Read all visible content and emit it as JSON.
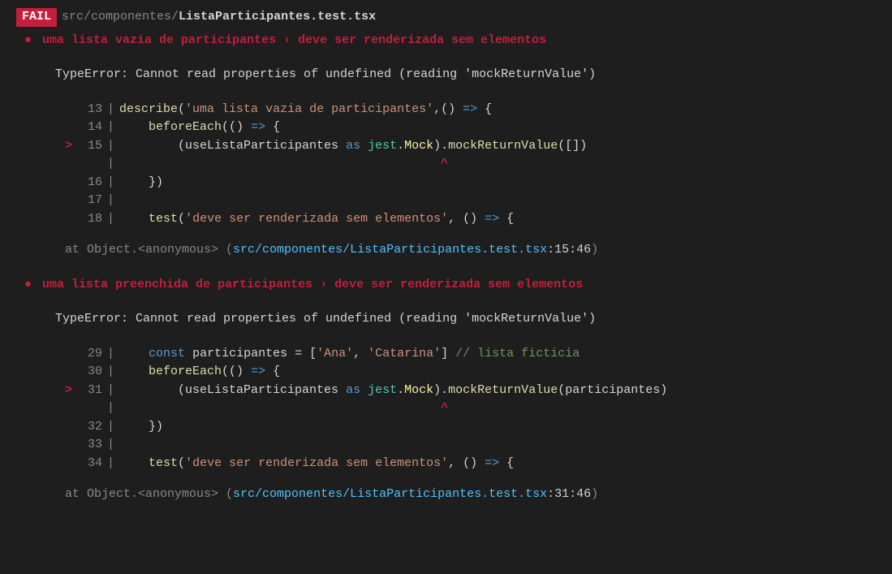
{
  "header": {
    "fail_label": "FAIL",
    "file_dir": "src/componentes/",
    "file_name": "ListaParticipantes.test.tsx"
  },
  "tests": [
    {
      "bullet": "●",
      "suite": "uma lista vazia de participantes",
      "chev": "›",
      "name": "deve ser renderizada sem elementos",
      "error": "TypeError: Cannot read properties of undefined (reading 'mockReturnValue')",
      "code": {
        "l13": {
          "num": "13",
          "marker": " ",
          "describe": "describe",
          "p1": "(",
          "str": "'uma lista vazia de participantes'",
          "p2": ",() ",
          "arrow": "=>",
          "p3": " {"
        },
        "l14": {
          "num": "14",
          "marker": " ",
          "indent": "    ",
          "before": "beforeEach",
          "p1": "(() ",
          "arrow": "=>",
          "p2": " {"
        },
        "l15": {
          "num": "15",
          "marker": ">",
          "indent": "        ",
          "p1": "(useListaParticipantes ",
          "as": "as",
          "sp1": " ",
          "jest": "jest",
          "dot1": ".",
          "mock": "Mock",
          "p2": ").",
          "mret": "mockReturnValue",
          "p3": "([])"
        },
        "caret": {
          "marker": " ",
          "num": "  ",
          "indent": "                                            ",
          "caret": "^"
        },
        "l16": {
          "num": "16",
          "marker": " ",
          "indent": "    ",
          "p1": "})"
        },
        "l17": {
          "num": "17",
          "marker": " "
        },
        "l18": {
          "num": "18",
          "marker": " ",
          "indent": "    ",
          "test": "test",
          "p1": "(",
          "str": "'deve ser renderizada sem elementos'",
          "p2": ", () ",
          "arrow": "=>",
          "p3": " {"
        }
      },
      "stack": {
        "prefix": "at Object.<anonymous> (",
        "file": "src/componentes/ListaParticipantes.test.tsx",
        "loc": ":15:46",
        "suffix": ")"
      }
    },
    {
      "bullet": "●",
      "suite": "uma lista preenchida de participantes",
      "chev": "›",
      "name": "deve ser renderizada sem elementos",
      "error": "TypeError: Cannot read properties of undefined (reading 'mockReturnValue')",
      "code": {
        "l29": {
          "num": "29",
          "marker": " ",
          "indent": "    ",
          "const": "const",
          "sp": " ",
          "var": "participantes",
          "eq": " = [",
          "s1": "'Ana'",
          "c1": ", ",
          "s2": "'Catarina'",
          "p1": "] ",
          "comment": "// lista ficticia"
        },
        "l30": {
          "num": "30",
          "marker": " ",
          "indent": "    ",
          "before": "beforeEach",
          "p1": "(() ",
          "arrow": "=>",
          "p2": " {"
        },
        "l31": {
          "num": "31",
          "marker": ">",
          "indent": "        ",
          "p1": "(useListaParticipantes ",
          "as": "as",
          "sp1": " ",
          "jest": "jest",
          "dot1": ".",
          "mock": "Mock",
          "p2": ").",
          "mret": "mockReturnValue",
          "p3": "(participantes)"
        },
        "caret": {
          "marker": " ",
          "num": "  ",
          "indent": "                                            ",
          "caret": "^"
        },
        "l32": {
          "num": "32",
          "marker": " ",
          "indent": "    ",
          "p1": "})"
        },
        "l33": {
          "num": "33",
          "marker": " "
        },
        "l34": {
          "num": "34",
          "marker": " ",
          "indent": "    ",
          "test": "test",
          "p1": "(",
          "str": "'deve ser renderizada sem elementos'",
          "p2": ", () ",
          "arrow": "=>",
          "p3": " {"
        }
      },
      "stack": {
        "prefix": "at Object.<anonymous> (",
        "file": "src/componentes/ListaParticipantes.test.tsx",
        "loc": ":31:46",
        "suffix": ")"
      }
    }
  ]
}
